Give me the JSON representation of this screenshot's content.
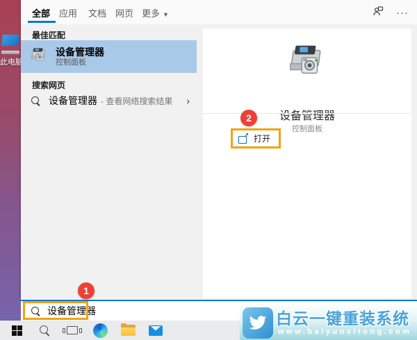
{
  "tabs": {
    "items": [
      {
        "label": "全部",
        "selected": true
      },
      {
        "label": "应用",
        "selected": false
      },
      {
        "label": "文档",
        "selected": false
      },
      {
        "label": "网页",
        "selected": false
      },
      {
        "label": "更多",
        "selected": false
      }
    ],
    "more_caret": "▼",
    "feedback_icon": "👤",
    "ellipsis_icon": "···"
  },
  "left_list": {
    "best_match_header": "最佳匹配",
    "best_match": {
      "title": "设备管理器",
      "subtitle": "控制面板"
    },
    "web_header": "搜索网页",
    "web_item": {
      "query": "设备管理器",
      "hint": "- 查看网络搜索结果",
      "chevron": "›"
    }
  },
  "detail": {
    "title": "设备管理器",
    "subtitle": "控制面板",
    "open_label": "打开"
  },
  "annotations": {
    "badge1": "1",
    "badge2": "2",
    "box_color": "#f2a20d",
    "badge_color": "#ee4035"
  },
  "searchbox": {
    "value": "设备管理器"
  },
  "desktop": {
    "this_pc_label": "此电脑"
  },
  "taskbar": {
    "icons": [
      "start",
      "search",
      "task-view",
      "edge",
      "file-explorer",
      "mail"
    ]
  },
  "watermark": {
    "title": "白云一键重装系统",
    "url": "www.baiyunxitong.com"
  },
  "colors": {
    "accent": "#0078d7",
    "highlight": "#a9c9e9",
    "panel_bg": "#f1f1f1",
    "watermark_blue": "#4ba2d8"
  }
}
